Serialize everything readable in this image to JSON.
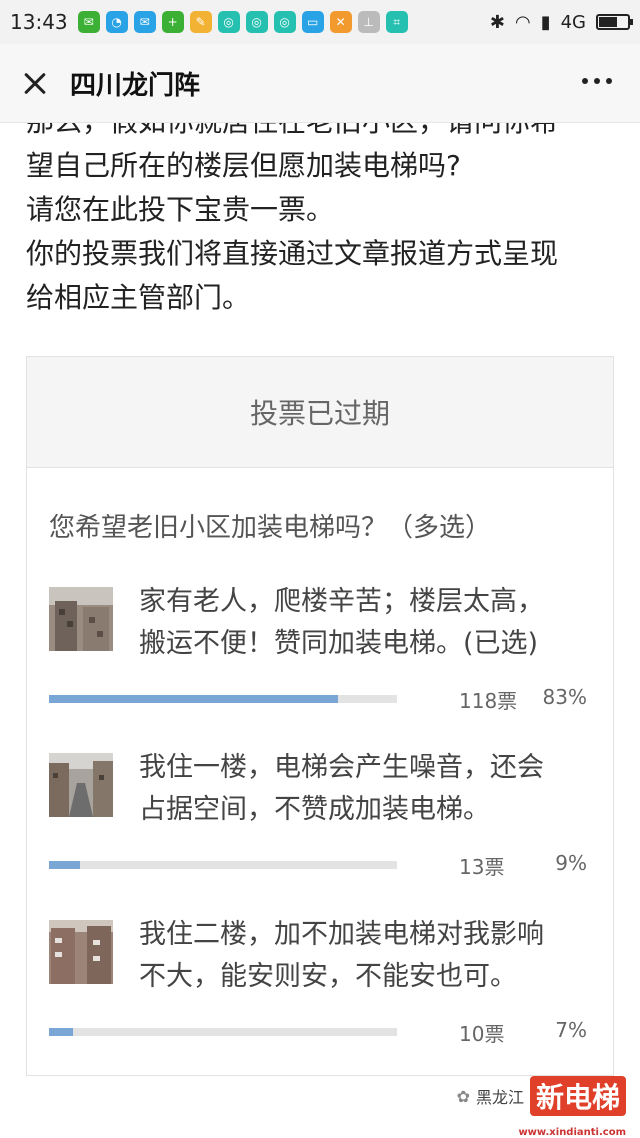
{
  "status_bar": {
    "time": "13:43",
    "network": "4G",
    "icons": [
      "wechat-icon",
      "qq-icon",
      "wechat-work-icon",
      "plus-app-icon",
      "brush-app-icon",
      "app-icon",
      "app-icon",
      "app-icon",
      "message-icon",
      "tools-icon",
      "cleaner-icon",
      "scan-icon"
    ],
    "colors": {
      "green": "#3cb034",
      "blue": "#2aa3e6",
      "teal": "#26c0b0",
      "orange": "#f29a2e"
    }
  },
  "header": {
    "title": "四川龙门阵"
  },
  "article": {
    "lines": [
      "那么，假如你就居住在老旧小区，请问你希",
      "望自己所在的楼层但愿加装电梯吗?",
      "请您在此投下宝贵一票。",
      "你的投票我们将直接通过文章报道方式呈现",
      "给相应主管部门。"
    ]
  },
  "vote": {
    "status": "投票已过期",
    "question": "您希望老旧小区加装电梯吗？（多选）",
    "options": [
      {
        "line1": "家有老人，爬楼辛苦；楼层太高，",
        "line2": "搬运不便！赞同加装电梯。(已选)",
        "count": "118票",
        "percent": "83%",
        "fraction": 0.83
      },
      {
        "line1": "我住一楼，电梯会产生噪音，还会",
        "line2": "占据空间，不赞成加装电梯。",
        "count": "13票",
        "percent": "9%",
        "fraction": 0.09
      },
      {
        "line1": "我住二楼，加不加装电梯对我影响",
        "line2": "不大，能安则安，不能安也可。",
        "count": "10票",
        "percent": "7%",
        "fraction": 0.07
      }
    ],
    "bar_color": "#7aa6d6",
    "track_color": "#e3e3e3"
  },
  "watermark": {
    "source": "黑龙江",
    "logo": "新电梯",
    "url": "www.xindianti.com"
  }
}
